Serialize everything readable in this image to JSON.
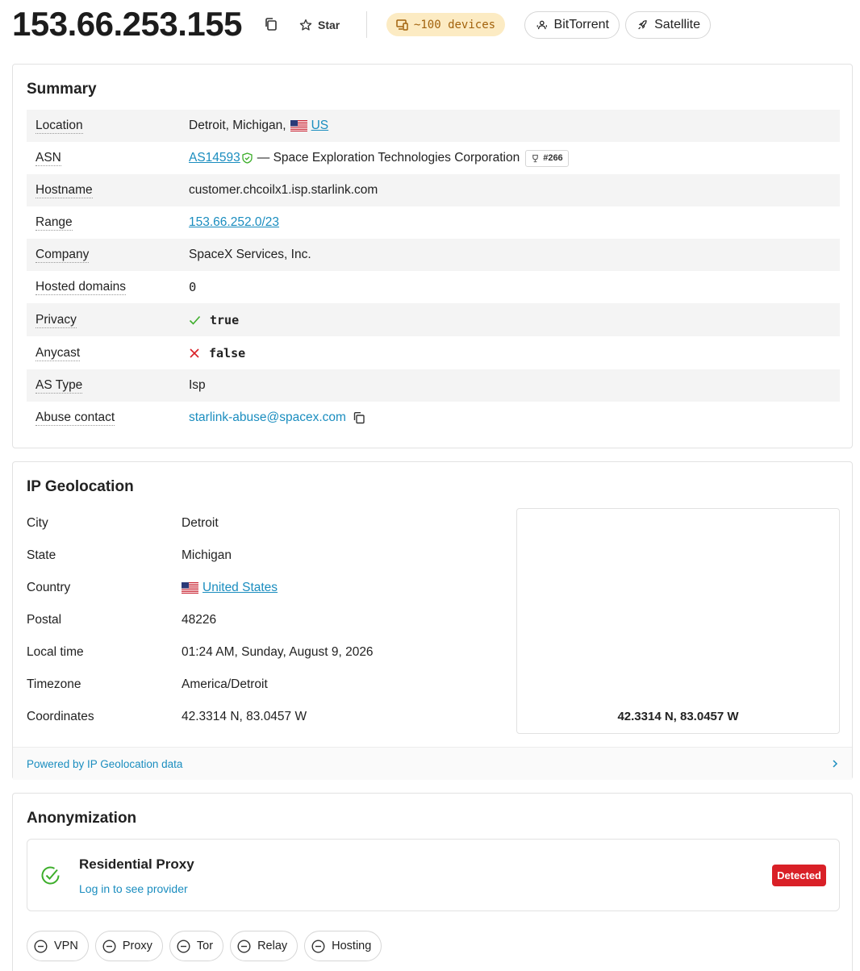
{
  "header": {
    "ip": "153.66.253.155",
    "star_label": "Star",
    "devices_label": "~100 devices",
    "pills": [
      {
        "label": "BitTorrent",
        "icon": "people-icon"
      },
      {
        "label": "Satellite",
        "icon": "rocket-icon"
      }
    ]
  },
  "summary": {
    "title": "Summary",
    "location": {
      "label": "Location",
      "city_state": "Detroit, Michigan,",
      "country_code": "US"
    },
    "asn": {
      "label": "ASN",
      "asn": "AS14593",
      "org": "— Space Exploration Technologies Corporation",
      "rank": "#266"
    },
    "hostname": {
      "label": "Hostname",
      "value": "customer.chcoilx1.isp.starlink.com"
    },
    "range": {
      "label": "Range",
      "value": "153.66.252.0/23"
    },
    "company": {
      "label": "Company",
      "value": "SpaceX Services, Inc."
    },
    "hosted_domains": {
      "label": "Hosted domains",
      "value": "0"
    },
    "privacy": {
      "label": "Privacy",
      "value": "true"
    },
    "anycast": {
      "label": "Anycast",
      "value": "false"
    },
    "as_type": {
      "label": "AS Type",
      "value": "Isp"
    },
    "abuse": {
      "label": "Abuse contact",
      "value": "starlink-abuse@spacex.com"
    }
  },
  "geolocation": {
    "title": "IP Geolocation",
    "city": {
      "label": "City",
      "value": "Detroit"
    },
    "state": {
      "label": "State",
      "value": "Michigan"
    },
    "country": {
      "label": "Country",
      "value": "United States"
    },
    "postal": {
      "label": "Postal",
      "value": "48226"
    },
    "local_time": {
      "label": "Local time",
      "value": "01:24 AM, Sunday, August 9, 2026"
    },
    "timezone": {
      "label": "Timezone",
      "value": "America/Detroit"
    },
    "coordinates": {
      "label": "Coordinates",
      "value": "42.3314 N, 83.0457 W"
    },
    "map_caption": "42.3314 N, 83.0457 W",
    "footer_link": "Powered by IP Geolocation data"
  },
  "anonymization": {
    "title": "Anonymization",
    "residential": {
      "title": "Residential Proxy",
      "sub": "Log in to see provider",
      "badge": "Detected"
    },
    "chips": [
      "VPN",
      "Proxy",
      "Tor",
      "Relay",
      "Hosting"
    ]
  },
  "colors": {
    "link": "#1a8dbf",
    "detected": "#d92027",
    "devices_bg": "#fcebc3",
    "devices_text": "#a2620c",
    "check_green": "#3dae2b",
    "cross_red": "#d92027"
  }
}
